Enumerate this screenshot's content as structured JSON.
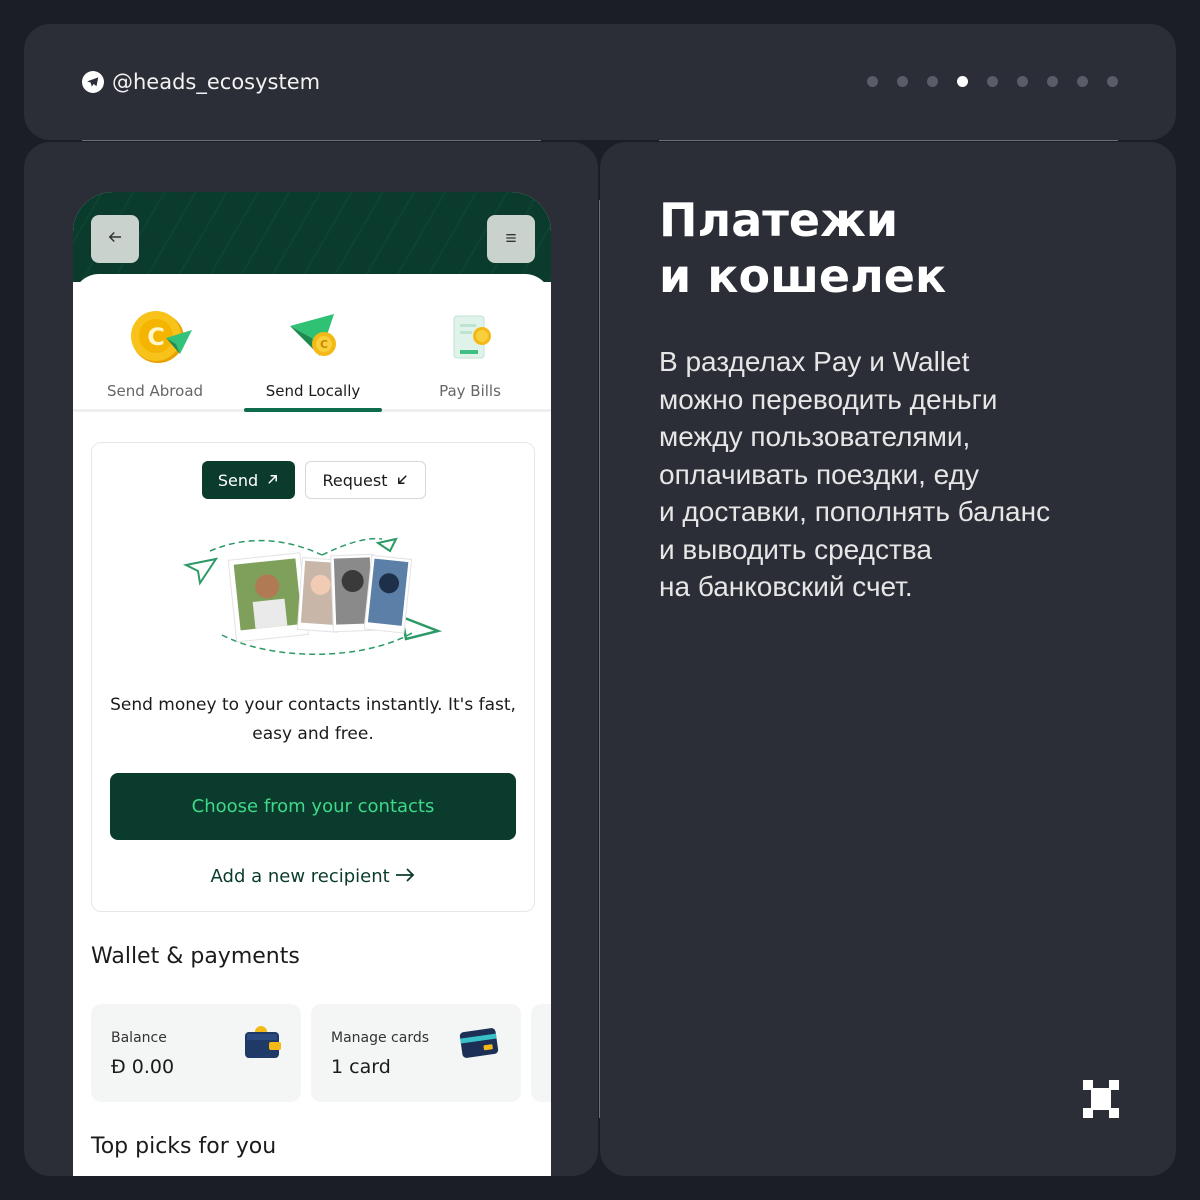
{
  "header": {
    "handle": "@heads_ecosystem",
    "pager": {
      "total": 9,
      "active_index": 3
    }
  },
  "phone": {
    "back_icon": "arrow-left-icon",
    "menu_icon": "menu-icon",
    "tabs": [
      {
        "label": "Send Abroad",
        "icon": "coin-plane-icon",
        "active": false
      },
      {
        "label": "Send Locally",
        "icon": "send-coin-icon",
        "active": true
      },
      {
        "label": "Pay Bills",
        "icon": "bill-coin-icon",
        "active": false
      }
    ],
    "toggle": {
      "send_label": "Send",
      "request_label": "Request"
    },
    "description": "Send money to your contacts instantly. It's fast, easy and free.",
    "contacts_button": "Choose from your contacts",
    "add_recipient": "Add a new recipient",
    "wallet_title": "Wallet & payments",
    "tiles": [
      {
        "label": "Balance",
        "value": "Ð 0.00",
        "icon": "wallet-icon"
      },
      {
        "label": "Manage cards",
        "value": "1 card",
        "icon": "card-icon"
      }
    ],
    "picks_title": "Top picks for you"
  },
  "content": {
    "heading_line1": "Платежи",
    "heading_line2": "и кошелек",
    "body": "В разделах Pay и Wallet\nможно переводить деньги\nмежду пользователями,\nоплачивать поездки, еду\nи доставки, пополнять баланс\nи выводить средства\nна банковский счет."
  },
  "colors": {
    "page_bg": "#1c1e25",
    "card_bg": "#2b2d37",
    "brand_dark_green": "#0a3b2c",
    "brand_green": "#3fd98a",
    "tab_underline": "#0f6b4e"
  }
}
